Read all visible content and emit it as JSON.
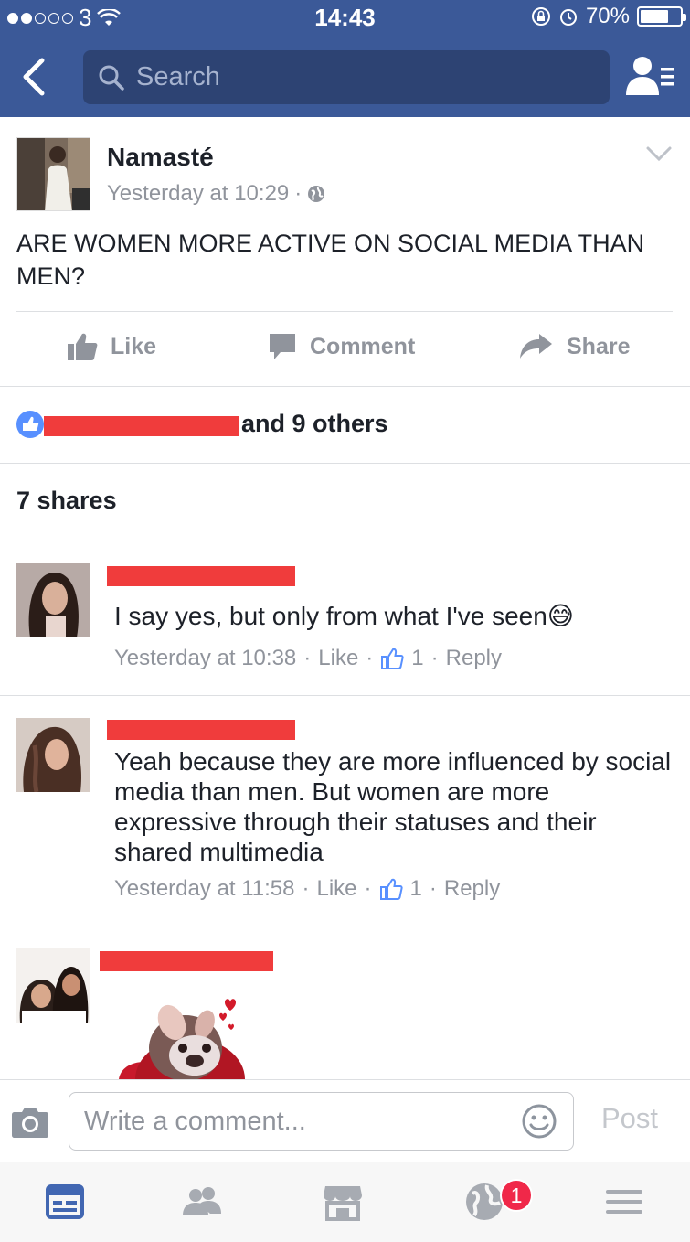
{
  "status": {
    "carrier": "3",
    "time": "14:43",
    "battery": "70%"
  },
  "nav": {
    "search_placeholder": "Search"
  },
  "post": {
    "author": "Namasté",
    "timestamp": "Yesterday at 10:29",
    "separator": "·",
    "text": "ARE WOMEN MORE ACTIVE ON SOCIAL MEDIA THAN MEN?",
    "actions": {
      "like": "Like",
      "comment": "Comment",
      "share": "Share"
    },
    "likes_summary": "and 9 others",
    "shares": "7 shares"
  },
  "comments": [
    {
      "text": "I say yes, but only from what I've seen😅",
      "time": "Yesterday at 10:38",
      "like": "Like",
      "count": "1",
      "reply": "Reply"
    },
    {
      "text": "Yeah because they are more influenced by social media than men.  But women are more expressive through their statuses and their shared multimedia",
      "time": "Yesterday at 11:58",
      "like": "Like",
      "count": "1",
      "reply": "Reply"
    },
    {
      "text": "",
      "sticker": "bulldog-sticker"
    }
  ],
  "composer": {
    "placeholder": "Write a comment...",
    "post_label": "Post"
  },
  "tabbar": {
    "notifications_badge": "1"
  },
  "colors": {
    "brand": "#3b5998",
    "meta_gray": "#90949c",
    "badge_red": "#f02849"
  }
}
